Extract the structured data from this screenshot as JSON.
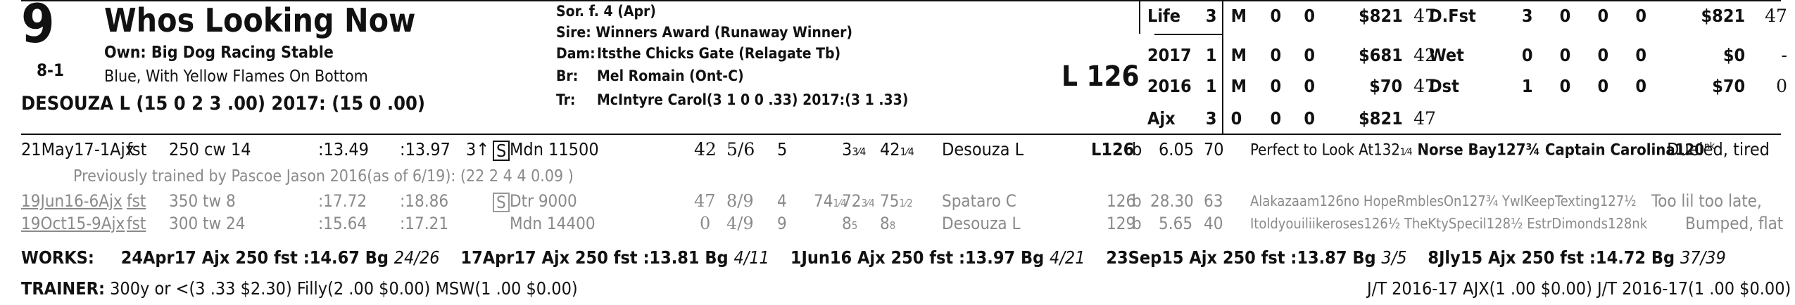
{
  "header": {
    "number": "9",
    "horse_name": "Whos Looking Now",
    "owner": "Own: Big Dog Racing Stable",
    "odds": "8-1",
    "silks": "Blue, With Yellow Flames On Bottom",
    "jockey": "DESOUZA L (15 0 2 3 .00) 2017: (15 0 .00)",
    "sex_age": "Sor. f. 4 (Apr)",
    "sire": "Sire: Winners Award (Runaway Winner)",
    "dam_label": "Dam:",
    "dam": "Itsthe Chicks Gate (Relagate Tb)",
    "br_label": "Br:",
    "br": "Mel Romain (Ont-C)",
    "tr_label": "Tr:",
    "tr": "McIntyre Carol(3 1 0 0 .33)  2017:(3 1 .33)",
    "weight": "L 126"
  },
  "record_left": [
    {
      "label": "Life",
      "n": "3",
      "m": "M",
      "a": "0",
      "b": "0",
      "earn": "$821",
      "fig": "47"
    },
    {
      "label": "2017",
      "n": "1",
      "m": "M",
      "a": "0",
      "b": "0",
      "earn": "$681",
      "fig": "42"
    },
    {
      "label": "2016",
      "n": "1",
      "m": "M",
      "a": "0",
      "b": "0",
      "earn": "$70",
      "fig": "47"
    },
    {
      "label": "Ajx",
      "n": "3",
      "m": "0",
      "a": "0",
      "b": "0",
      "earn": "$821",
      "fig": "47"
    }
  ],
  "record_right": [
    {
      "label": "D.Fst",
      "n": "3",
      "m": "0",
      "a": "0",
      "b": "0",
      "earn": "$821",
      "fig": "47"
    },
    {
      "label": "Wet",
      "n": "0",
      "m": "0",
      "a": "0",
      "b": "0",
      "earn": "$0",
      "fig": "-"
    },
    {
      "label": "Dst",
      "n": "1",
      "m": "0",
      "a": "0",
      "b": "0",
      "earn": "$70",
      "fig": "0"
    }
  ],
  "race1": {
    "date": "21May17-1Ajx",
    "cond": "fst",
    "dist": "250 cw 14",
    "t1": ":13.49",
    "t2": ":13.97",
    "age": "3↑",
    "s": "S",
    "class": "Mdn 11500",
    "fig": "42",
    "pp": "5/6",
    "start": "5",
    "c1": "3",
    "c1f": "3⁄4",
    "c2": "42",
    "c2f": "1⁄4",
    "jockey": "Desouza L",
    "weight": "L126",
    "med": "b",
    "odds": "6.05",
    "spd": "70",
    "comment_pre": "Perfect to Look At132",
    "comment_pre_f": "1⁄4",
    "comment_bold": " Norse Bay127¾ Captain Carolina120",
    "comment_nk": "nk",
    "remark": "Dueled, tired"
  },
  "trainer_note": "Previously trained by Pascoe Jason 2016(as of 6/19): (22 2 4 4 0.09 )",
  "race2": {
    "date": "19Jun16-6Ajx",
    "cond": "fst",
    "dist": "350 tw 8",
    "t1": ":17.72",
    "t2": ":18.86",
    "s": "S",
    "class": "Dtr 9000",
    "fig": "47",
    "pp": "8/9",
    "start": "4",
    "c0": "74",
    "c0f": "1⁄4",
    "c1": "72",
    "c1f": "3⁄4",
    "c2": "75",
    "c2f": "1⁄2",
    "jockey": "Spataro C",
    "weight": "126",
    "med": "b",
    "odds": "28.30",
    "spd": "63",
    "comment": "Alakazaam126no HopeRmblesOn127¾ YwlKeepTexting127½",
    "remark": "Too lil too late,"
  },
  "race3": {
    "date": "19Oct15-9Ajx",
    "cond": "fst",
    "dist": "300 tw 24",
    "t1": ":15.64",
    "t2": ":17.21",
    "class": "Mdn 14400",
    "fig": "0",
    "pp": "4/9",
    "start": "9",
    "c1": "8",
    "c1f": "5",
    "c2": "8",
    "c2f": "8",
    "jockey": "Desouza L",
    "weight": "129",
    "med": "b",
    "odds": "5.65",
    "spd": "40",
    "comment": "Itoldyouiliikeroses126½ TheKtySpecil128½ EstrDimonds128nk",
    "remark": "Bumped, flat"
  },
  "works": {
    "label": "WORKS:",
    "items": [
      {
        "date": "24Apr17",
        "track": "Ajx",
        "dist": "250 fst",
        "time": ":14.67",
        "grade": "Bg",
        "rank": "24/26"
      },
      {
        "date": "17Apr17",
        "track": "Ajx",
        "dist": "250 fst",
        "time": ":13.81",
        "grade": "Bg",
        "rank": "4/11"
      },
      {
        "date": "1Jun16",
        "track": "Ajx",
        "dist": "250 fst",
        "time": ":13.97",
        "grade": "Bg",
        "rank": "4/21"
      },
      {
        "date": "23Sep15",
        "track": "Ajx",
        "dist": "250 fst",
        "time": ":13.87",
        "grade": "Bg",
        "rank": "3/5"
      },
      {
        "date": "8Jly15",
        "track": "Ajx",
        "dist": "250 fst",
        "time": ":14.72",
        "grade": "Bg",
        "rank": "37/39"
      }
    ]
  },
  "trainer_stats": {
    "label": "TRAINER:",
    "text": "300y or <(3 .33 $2.30) Filly(2 .00 $0.00) MSW(1 .00 $0.00)",
    "right": "J/T 2016-17 AJX(1 .00 $0.00)  J/T 2016-17(1 .00 $0.00)"
  }
}
